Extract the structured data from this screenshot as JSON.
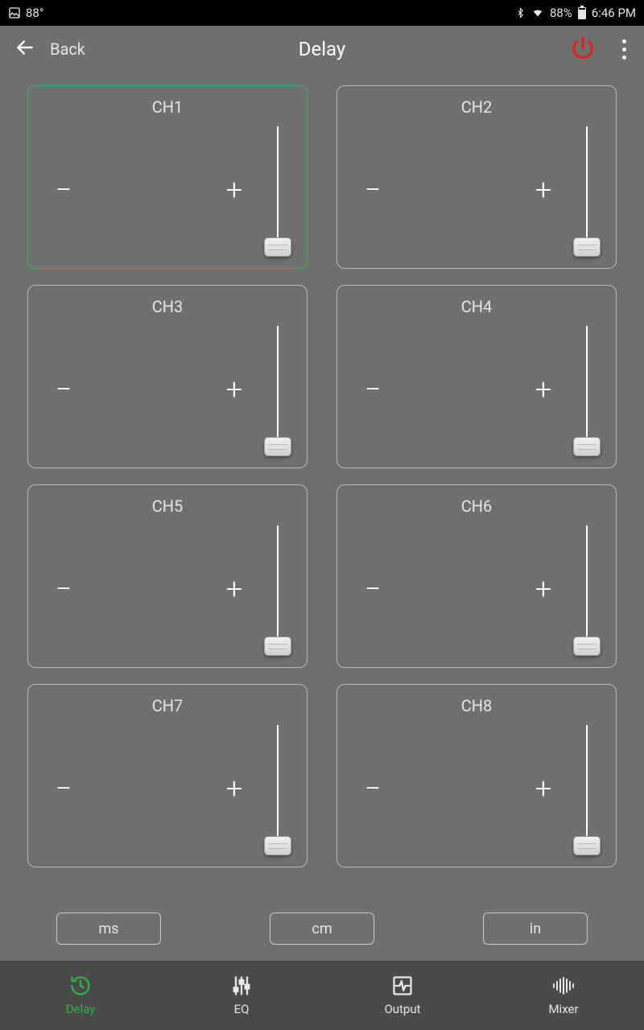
{
  "status_bar": {
    "temp_badge": "88°",
    "battery_pct": "88%",
    "time": "6:46 PM"
  },
  "header": {
    "back_label": "Back",
    "title": "Delay"
  },
  "channels": [
    {
      "label": "CH1",
      "selected": true
    },
    {
      "label": "CH2",
      "selected": false
    },
    {
      "label": "CH3",
      "selected": false
    },
    {
      "label": "CH4",
      "selected": false
    },
    {
      "label": "CH5",
      "selected": false
    },
    {
      "label": "CH6",
      "selected": false
    },
    {
      "label": "CH7",
      "selected": false
    },
    {
      "label": "CH8",
      "selected": false
    }
  ],
  "units": {
    "ms": "ms",
    "cm": "cm",
    "in": "in"
  },
  "nav": {
    "delay": "Delay",
    "eq": "EQ",
    "output": "Output",
    "mixer": "Mixer",
    "active": "delay"
  },
  "glyphs": {
    "minus": "−",
    "plus": "+"
  }
}
